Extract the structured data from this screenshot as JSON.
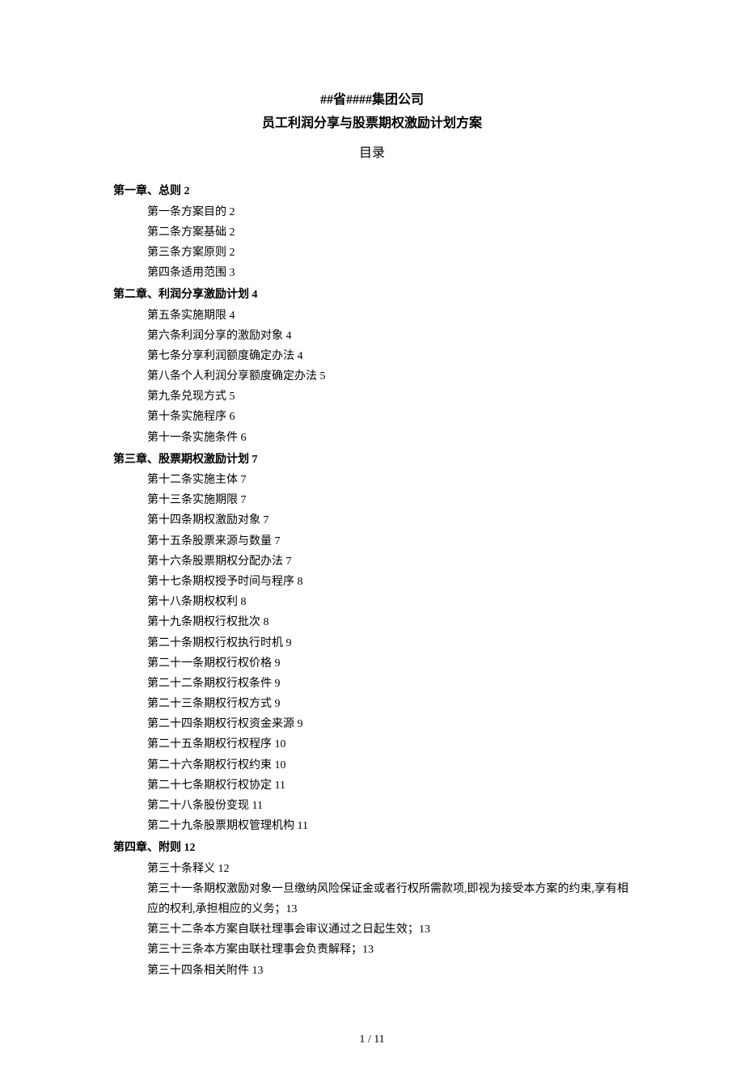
{
  "title": {
    "line1": "##省####集团公司",
    "line2": "员工利润分享与股票期权激励计划方案"
  },
  "toc_title": "目录",
  "chapters": [
    {
      "heading": "第一章、总则 2",
      "items": [
        "第一条方案目的 2",
        "第二条方案基础 2",
        "第三条方案原则 2",
        "第四条适用范围 3"
      ]
    },
    {
      "heading": "第二章、利润分享激励计划 4",
      "items": [
        "第五条实施期限 4",
        "第六条利润分享的激励对象 4",
        "第七条分享利润额度确定办法 4",
        "第八条个人利润分享额度确定办法 5",
        "第九条兑现方式 5",
        "第十条实施程序 6",
        "第十一条实施条件 6"
      ]
    },
    {
      "heading": "第三章、股票期权激励计划 7",
      "items": [
        "第十二条实施主体 7",
        "第十三条实施期限 7",
        "第十四条期权激励对象 7",
        "第十五条股票来源与数量 7",
        "第十六条股票期权分配办法 7",
        "第十七条期权授予时间与程序 8",
        "第十八条期权权利 8",
        "第十九条期权行权批次 8",
        "第二十条期权行权执行时机 9",
        "第二十一条期权行权价格 9",
        "第二十二条期权行权条件 9",
        "第二十三条期权行权方式 9",
        "第二十四条期权行权资金来源 9",
        "第二十五条期权行权程序 10",
        "第二十六条期权行权约束 10",
        "第二十七条期权行权协定 11",
        "第二十八条股份变现 11",
        "第二十九条股票期权管理机构 11"
      ]
    },
    {
      "heading": "第四章、附则 12",
      "items": [
        "第三十条释义 12",
        "第三十一条期权激励对象一旦缴纳风险保证金或者行权所需款项,即视为接受本方案的约束,享有相应的权利,承担相应的义务；13",
        "第三十二条本方案自联社理事会审议通过之日起生效；13",
        "第三十三条本方案由联社理事会负责解释；13",
        "第三十四条相关附件 13"
      ]
    }
  ],
  "page_number": "1 / 11"
}
